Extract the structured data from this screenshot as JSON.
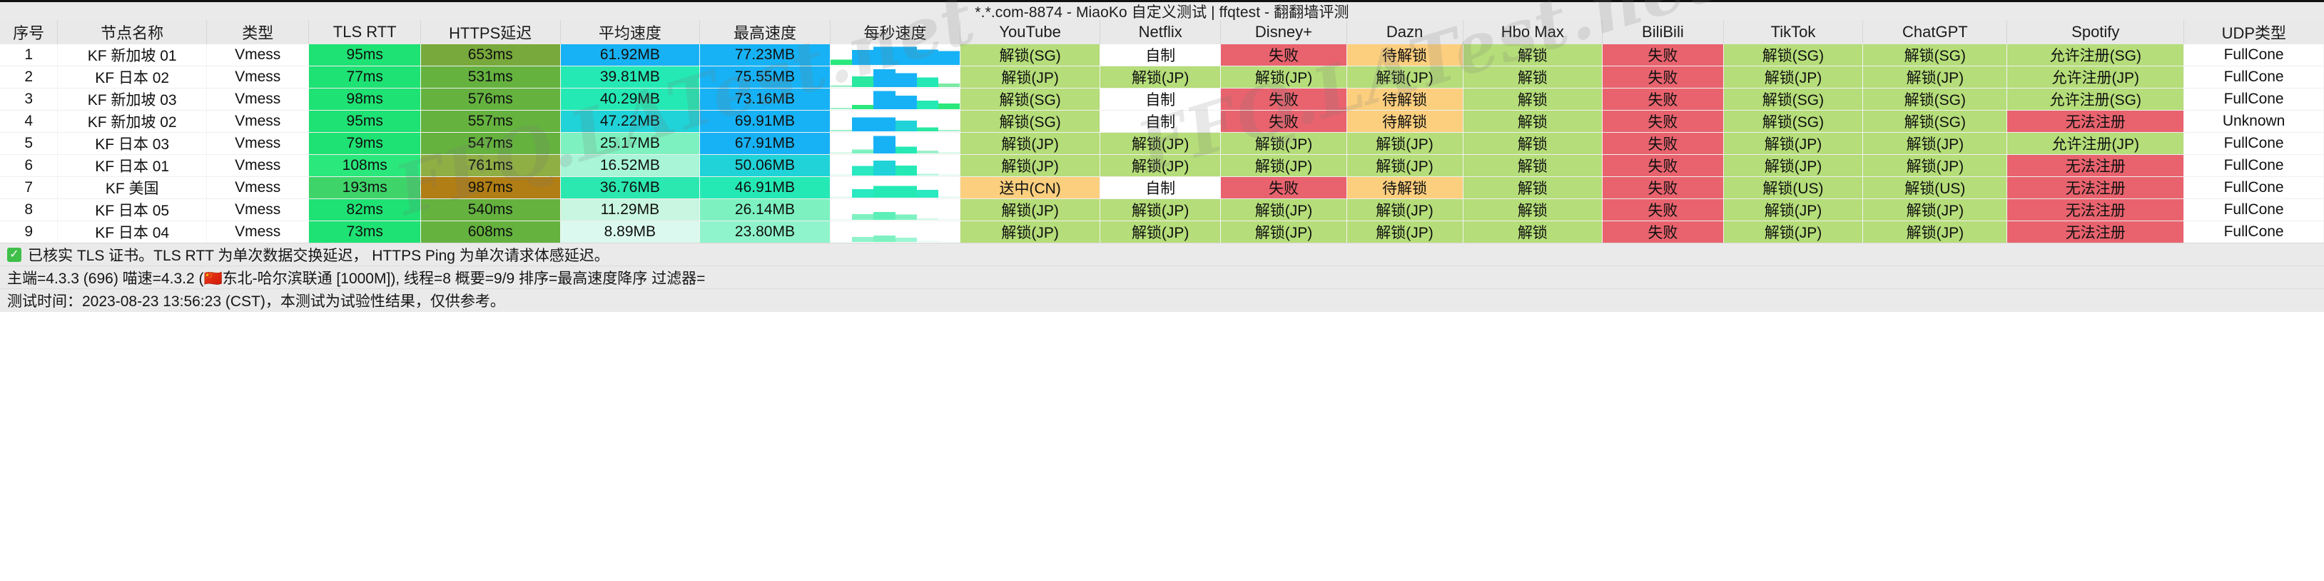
{
  "window": {
    "title": "*.*.com-8874 - MiaoKo 自定义测试 | ffqtest - 翻翻墙评测"
  },
  "watermark": {
    "text": "FFQ.LATest.net"
  },
  "table": {
    "columns": [
      {
        "key": "idx",
        "label": "序号",
        "width": 62
      },
      {
        "key": "name",
        "label": "节点名称",
        "width": 160
      },
      {
        "key": "type",
        "label": "类型",
        "width": 110
      },
      {
        "key": "tls_rtt",
        "label": "TLS RTT",
        "width": 120
      },
      {
        "key": "https",
        "label": "HTTPS延迟",
        "width": 150
      },
      {
        "key": "avg",
        "label": "平均速度",
        "width": 150
      },
      {
        "key": "max",
        "label": "最高速度",
        "width": 140
      },
      {
        "key": "spark",
        "label": "每秒速度",
        "width": 140
      },
      {
        "key": "youtube",
        "label": "YouTube",
        "width": 150
      },
      {
        "key": "netflix",
        "label": "Netflix",
        "width": 130
      },
      {
        "key": "disney",
        "label": "Disney+",
        "width": 135
      },
      {
        "key": "dazn",
        "label": "Dazn",
        "width": 125
      },
      {
        "key": "hbomax",
        "label": "Hbo Max",
        "width": 150
      },
      {
        "key": "bilibili",
        "label": "BiliBili",
        "width": 130
      },
      {
        "key": "tiktok",
        "label": "TikTok",
        "width": 150
      },
      {
        "key": "chatgpt",
        "label": "ChatGPT",
        "width": 155
      },
      {
        "key": "spotify",
        "label": "Spotify",
        "width": 190
      },
      {
        "key": "udp",
        "label": "UDP类型",
        "width": 150
      }
    ],
    "rows": [
      {
        "idx": "1",
        "name": "KF 新加坡 01",
        "type": "Vmess",
        "tls_rtt": "95ms",
        "tls_rtt_bg": "#1ee273",
        "https": "653ms",
        "https_bg": "#78a93c",
        "avg": "61.92MB",
        "avg_bg": "#17b2f5",
        "max": "77.23MB",
        "max_bg": "#17b2f5",
        "spark": [
          {
            "h": 28,
            "c": "#2ae87c"
          },
          {
            "h": 78,
            "c": "#17b2f5"
          },
          {
            "h": 95,
            "c": "#17b2f5"
          },
          {
            "h": 95,
            "c": "#17b2f5"
          },
          {
            "h": 80,
            "c": "#17b2f5"
          },
          {
            "h": 72,
            "c": "#17b2f5"
          }
        ],
        "youtube": "解锁(SG)",
        "youtube_bg": "#b5dd79",
        "netflix": "自制",
        "netflix_bg": "#ffffff",
        "disney": "失败",
        "disney_bg": "#e8636e",
        "dazn": "待解锁",
        "dazn_bg": "#fccf7f",
        "hbomax": "解锁",
        "hbomax_bg": "#b5dd79",
        "bilibili": "失败",
        "bilibili_bg": "#e8636e",
        "tiktok": "解锁(SG)",
        "tiktok_bg": "#b5dd79",
        "chatgpt": "解锁(SG)",
        "chatgpt_bg": "#b5dd79",
        "spotify": "允许注册(SG)",
        "spotify_bg": "#b5dd79",
        "udp": "FullCone",
        "udp_bg": "#ffffff"
      },
      {
        "idx": "2",
        "name": "KF 日本 02",
        "type": "Vmess",
        "tls_rtt": "77ms",
        "tls_rtt_bg": "#1ee273",
        "https": "531ms",
        "https_bg": "#65b23f",
        "avg": "39.81MB",
        "avg_bg": "#25e9b5",
        "max": "75.55MB",
        "max_bg": "#17b2f5",
        "spark": [
          {
            "h": 10,
            "c": "#9df0c8"
          },
          {
            "h": 55,
            "c": "#2ae8a0"
          },
          {
            "h": 92,
            "c": "#17b2f5"
          },
          {
            "h": 72,
            "c": "#17b2f5"
          },
          {
            "h": 50,
            "c": "#25e9b5"
          },
          {
            "h": 18,
            "c": "#7ceaa4"
          }
        ],
        "youtube": "解锁(JP)",
        "youtube_bg": "#b5dd79",
        "netflix": "解锁(JP)",
        "netflix_bg": "#b5dd79",
        "disney": "解锁(JP)",
        "disney_bg": "#b5dd79",
        "dazn": "解锁(JP)",
        "dazn_bg": "#b5dd79",
        "hbomax": "解锁",
        "hbomax_bg": "#b5dd79",
        "bilibili": "失败",
        "bilibili_bg": "#e8636e",
        "tiktok": "解锁(JP)",
        "tiktok_bg": "#b5dd79",
        "chatgpt": "解锁(JP)",
        "chatgpt_bg": "#b5dd79",
        "spotify": "允许注册(JP)",
        "spotify_bg": "#b5dd79",
        "udp": "FullCone",
        "udp_bg": "#ffffff"
      },
      {
        "idx": "3",
        "name": "KF 新加坡 03",
        "type": "Vmess",
        "tls_rtt": "98ms",
        "tls_rtt_bg": "#1ee273",
        "https": "576ms",
        "https_bg": "#65b23f",
        "avg": "40.29MB",
        "avg_bg": "#25e9b5",
        "max": "73.16MB",
        "max_bg": "#17b2f5",
        "spark": [
          {
            "h": 8,
            "c": "#9df0c8"
          },
          {
            "h": 22,
            "c": "#2ae87c"
          },
          {
            "h": 95,
            "c": "#17b2f5"
          },
          {
            "h": 70,
            "c": "#17b2f5"
          },
          {
            "h": 45,
            "c": "#25e9b5"
          },
          {
            "h": 30,
            "c": "#2ae87c"
          }
        ],
        "youtube": "解锁(SG)",
        "youtube_bg": "#b5dd79",
        "netflix": "自制",
        "netflix_bg": "#ffffff",
        "disney": "失败",
        "disney_bg": "#e8636e",
        "dazn": "待解锁",
        "dazn_bg": "#fccf7f",
        "hbomax": "解锁",
        "hbomax_bg": "#b5dd79",
        "bilibili": "失败",
        "bilibili_bg": "#e8636e",
        "tiktok": "解锁(SG)",
        "tiktok_bg": "#b5dd79",
        "chatgpt": "解锁(SG)",
        "chatgpt_bg": "#b5dd79",
        "spotify": "允许注册(SG)",
        "spotify_bg": "#b5dd79",
        "udp": "FullCone",
        "udp_bg": "#ffffff"
      },
      {
        "idx": "4",
        "name": "KF 新加坡 02",
        "type": "Vmess",
        "tls_rtt": "95ms",
        "tls_rtt_bg": "#1ee273",
        "https": "557ms",
        "https_bg": "#65b23f",
        "avg": "47.22MB",
        "avg_bg": "#1fd3d8",
        "max": "69.91MB",
        "max_bg": "#17b2f5",
        "spark": [
          {
            "h": 8,
            "c": "#9df0c8"
          },
          {
            "h": 72,
            "c": "#17b2f5"
          },
          {
            "h": 72,
            "c": "#17b2f5"
          },
          {
            "h": 55,
            "c": "#1fd3d8"
          },
          {
            "h": 20,
            "c": "#2ae8a0"
          },
          {
            "h": 8,
            "c": "#9df0c8"
          }
        ],
        "youtube": "解锁(SG)",
        "youtube_bg": "#b5dd79",
        "netflix": "自制",
        "netflix_bg": "#ffffff",
        "disney": "失败",
        "disney_bg": "#e8636e",
        "dazn": "待解锁",
        "dazn_bg": "#fccf7f",
        "hbomax": "解锁",
        "hbomax_bg": "#b5dd79",
        "bilibili": "失败",
        "bilibili_bg": "#e8636e",
        "tiktok": "解锁(SG)",
        "tiktok_bg": "#b5dd79",
        "chatgpt": "解锁(SG)",
        "chatgpt_bg": "#b5dd79",
        "spotify": "无法注册",
        "spotify_bg": "#e8636e",
        "udp": "Unknown",
        "udp_bg": "#ffffff"
      },
      {
        "idx": "5",
        "name": "KF 日本 03",
        "type": "Vmess",
        "tls_rtt": "79ms",
        "tls_rtt_bg": "#1ee273",
        "https": "547ms",
        "https_bg": "#65b23f",
        "avg": "25.17MB",
        "avg_bg": "#7df2c0",
        "max": "67.91MB",
        "max_bg": "#17b2f5",
        "spark": [
          {
            "h": 6,
            "c": "#c9f6e0"
          },
          {
            "h": 20,
            "c": "#7df2c0"
          },
          {
            "h": 90,
            "c": "#17b2f5"
          },
          {
            "h": 35,
            "c": "#25e9b5"
          },
          {
            "h": 14,
            "c": "#9df0c8"
          },
          {
            "h": 6,
            "c": "#c9f6e0"
          }
        ],
        "youtube": "解锁(JP)",
        "youtube_bg": "#b5dd79",
        "netflix": "解锁(JP)",
        "netflix_bg": "#b5dd79",
        "disney": "解锁(JP)",
        "disney_bg": "#b5dd79",
        "dazn": "解锁(JP)",
        "dazn_bg": "#b5dd79",
        "hbomax": "解锁",
        "hbomax_bg": "#b5dd79",
        "bilibili": "失败",
        "bilibili_bg": "#e8636e",
        "tiktok": "解锁(JP)",
        "tiktok_bg": "#b5dd79",
        "chatgpt": "解锁(JP)",
        "chatgpt_bg": "#b5dd79",
        "spotify": "允许注册(JP)",
        "spotify_bg": "#b5dd79",
        "udp": "FullCone",
        "udp_bg": "#ffffff"
      },
      {
        "idx": "6",
        "name": "KF 日本 01",
        "type": "Vmess",
        "tls_rtt": "108ms",
        "tls_rtt_bg": "#2ae87c",
        "https": "761ms",
        "https_bg": "#8fae44",
        "avg": "16.52MB",
        "avg_bg": "#a8f5d8",
        "max": "50.06MB",
        "max_bg": "#1fd3d8",
        "spark": [
          {
            "h": 5,
            "c": "#d9f8ec"
          },
          {
            "h": 50,
            "c": "#2ae8c0"
          },
          {
            "h": 78,
            "c": "#1fd3d8"
          },
          {
            "h": 52,
            "c": "#25e9b5"
          },
          {
            "h": 10,
            "c": "#b6f4dc"
          },
          {
            "h": 5,
            "c": "#d9f8ec"
          }
        ],
        "youtube": "解锁(JP)",
        "youtube_bg": "#b5dd79",
        "netflix": "解锁(JP)",
        "netflix_bg": "#b5dd79",
        "disney": "解锁(JP)",
        "disney_bg": "#b5dd79",
        "dazn": "解锁(JP)",
        "dazn_bg": "#b5dd79",
        "hbomax": "解锁",
        "hbomax_bg": "#b5dd79",
        "bilibili": "失败",
        "bilibili_bg": "#e8636e",
        "tiktok": "解锁(JP)",
        "tiktok_bg": "#b5dd79",
        "chatgpt": "解锁(JP)",
        "chatgpt_bg": "#b5dd79",
        "spotify": "无法注册",
        "spotify_bg": "#e8636e",
        "udp": "FullCone",
        "udp_bg": "#ffffff"
      },
      {
        "idx": "7",
        "name": "KF 美国",
        "type": "Vmess",
        "tls_rtt": "193ms",
        "tls_rtt_bg": "#3fd46a",
        "https": "987ms",
        "https_bg": "#b07e14",
        "avg": "36.76MB",
        "avg_bg": "#2ae8b0",
        "max": "46.91MB",
        "max_bg": "#25e9b5",
        "spark": [
          {
            "h": 5,
            "c": "#d9f8ec"
          },
          {
            "h": 45,
            "c": "#2ae8c0"
          },
          {
            "h": 62,
            "c": "#25e9b5"
          },
          {
            "h": 62,
            "c": "#25e9b5"
          },
          {
            "h": 40,
            "c": "#2ae8c0"
          },
          {
            "h": 5,
            "c": "#d9f8ec"
          }
        ],
        "youtube": "送中(CN)",
        "youtube_bg": "#fccf7f",
        "netflix": "自制",
        "netflix_bg": "#ffffff",
        "disney": "失败",
        "disney_bg": "#e8636e",
        "dazn": "待解锁",
        "dazn_bg": "#fccf7f",
        "hbomax": "解锁",
        "hbomax_bg": "#b5dd79",
        "bilibili": "失败",
        "bilibili_bg": "#e8636e",
        "tiktok": "解锁(US)",
        "tiktok_bg": "#b5dd79",
        "chatgpt": "解锁(US)",
        "chatgpt_bg": "#b5dd79",
        "spotify": "无法注册",
        "spotify_bg": "#e8636e",
        "udp": "FullCone",
        "udp_bg": "#ffffff"
      },
      {
        "idx": "8",
        "name": "KF 日本 05",
        "type": "Vmess",
        "tls_rtt": "82ms",
        "tls_rtt_bg": "#1ee273",
        "https": "540ms",
        "https_bg": "#65b23f",
        "avg": "11.29MB",
        "avg_bg": "#c9f6e0",
        "max": "26.14MB",
        "max_bg": "#7df2c0",
        "spark": [
          {
            "h": 4,
            "c": "#e6fbf3"
          },
          {
            "h": 30,
            "c": "#7df2c0"
          },
          {
            "h": 40,
            "c": "#5defb8"
          },
          {
            "h": 28,
            "c": "#7df2c0"
          },
          {
            "h": 8,
            "c": "#cdf7e3"
          },
          {
            "h": 4,
            "c": "#e6fbf3"
          }
        ],
        "youtube": "解锁(JP)",
        "youtube_bg": "#b5dd79",
        "netflix": "解锁(JP)",
        "netflix_bg": "#b5dd79",
        "disney": "解锁(JP)",
        "disney_bg": "#b5dd79",
        "dazn": "解锁(JP)",
        "dazn_bg": "#b5dd79",
        "hbomax": "解锁",
        "hbomax_bg": "#b5dd79",
        "bilibili": "失败",
        "bilibili_bg": "#e8636e",
        "tiktok": "解锁(JP)",
        "tiktok_bg": "#b5dd79",
        "chatgpt": "解锁(JP)",
        "chatgpt_bg": "#b5dd79",
        "spotify": "无法注册",
        "spotify_bg": "#e8636e",
        "udp": "FullCone",
        "udp_bg": "#ffffff"
      },
      {
        "idx": "9",
        "name": "KF 日本 04",
        "type": "Vmess",
        "tls_rtt": "73ms",
        "tls_rtt_bg": "#1ee273",
        "https": "608ms",
        "https_bg": "#65b23f",
        "avg": "8.89MB",
        "avg_bg": "#dbf9ee",
        "max": "23.80MB",
        "max_bg": "#8ff3cb",
        "spark": [
          {
            "h": 4,
            "c": "#effdf8"
          },
          {
            "h": 26,
            "c": "#8ff3cb"
          },
          {
            "h": 34,
            "c": "#7df2c0"
          },
          {
            "h": 22,
            "c": "#9df5d3"
          },
          {
            "h": 6,
            "c": "#e0fbf2"
          },
          {
            "h": 4,
            "c": "#effdf8"
          }
        ],
        "youtube": "解锁(JP)",
        "youtube_bg": "#b5dd79",
        "netflix": "解锁(JP)",
        "netflix_bg": "#b5dd79",
        "disney": "解锁(JP)",
        "disney_bg": "#b5dd79",
        "dazn": "解锁(JP)",
        "dazn_bg": "#b5dd79",
        "hbomax": "解锁",
        "hbomax_bg": "#b5dd79",
        "bilibili": "失败",
        "bilibili_bg": "#e8636e",
        "tiktok": "解锁(JP)",
        "tiktok_bg": "#b5dd79",
        "chatgpt": "解锁(JP)",
        "chatgpt_bg": "#b5dd79",
        "spotify": "无法注册",
        "spotify_bg": "#e8636e",
        "udp": "FullCone",
        "udp_bg": "#ffffff"
      }
    ]
  },
  "footer": {
    "check_icon": "check-mark",
    "note_line": "已核实 TLS 证书。TLS RTT 为单次数据交换延迟，  HTTPS Ping 为单次请求体感延迟。",
    "meta_line": "主端=4.3.3 (696) 喵速=4.3.2 (🇨🇳东北-哈尔滨联通 [1000M]), 线程=8 概要=9/9 排序=最高速度降序 过滤器=",
    "time_line": "测试时间：2023-08-23 13:56:23 (CST)，本测试为试验性结果，仅供参考。"
  },
  "colors": {
    "header_bg": "#e9e9e9",
    "unlock_green": "#b5dd79",
    "fail_red": "#e8636e",
    "pending_orange": "#fccf7f",
    "speed_blue": "#17b2f5",
    "rtt_green": "#1ee273",
    "latency_green": "#65b23f"
  }
}
